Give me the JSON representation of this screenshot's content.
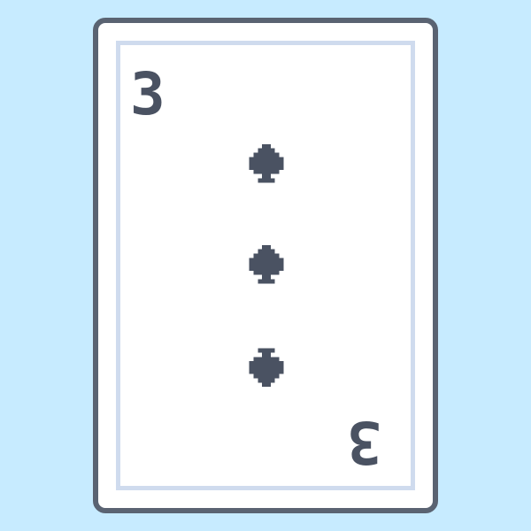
{
  "colors": {
    "background": "#c7ebff",
    "card_face": "#ffffff",
    "card_border": "#5a6372",
    "inner_frame": "#cfdbee",
    "ink": "#4a5262"
  },
  "card": {
    "rank": "3",
    "suit": "spades",
    "pip_count": 3,
    "suit_icon": "spade-icon"
  }
}
